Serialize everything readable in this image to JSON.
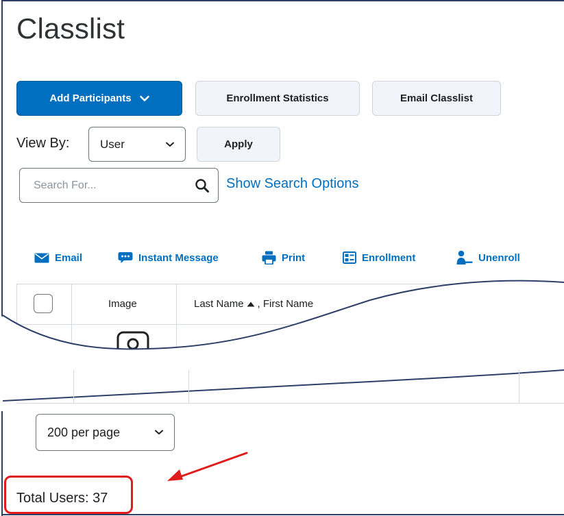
{
  "page": {
    "title": "Classlist"
  },
  "toolbar": {
    "add_participants_label": "Add Participants",
    "enrollment_statistics_label": "Enrollment Statistics",
    "email_classlist_label": "Email Classlist"
  },
  "view_by": {
    "label": "View By:",
    "selected": "User",
    "apply_label": "Apply"
  },
  "search": {
    "placeholder": "Search For...",
    "value": "",
    "show_options_label": "Show Search Options"
  },
  "actions": [
    {
      "label": "Email",
      "icon": "envelope-icon"
    },
    {
      "label": "Instant Message",
      "icon": "chat-icon"
    },
    {
      "label": "Print",
      "icon": "printer-icon"
    },
    {
      "label": "Enrollment",
      "icon": "enrollment-icon"
    },
    {
      "label": "Unenroll",
      "icon": "unenroll-user-icon"
    }
  ],
  "table": {
    "columns": {
      "image": "Image",
      "last_name": "Last Name",
      "first_name": ", First Name"
    },
    "sort": "ascending"
  },
  "pagination": {
    "per_page_selected": "200 per page"
  },
  "footer": {
    "total_users": "Total Users: 37"
  },
  "colors": {
    "primary": "#006fbf",
    "annotation": "#e01b1b",
    "frame": "#2d3f66"
  }
}
